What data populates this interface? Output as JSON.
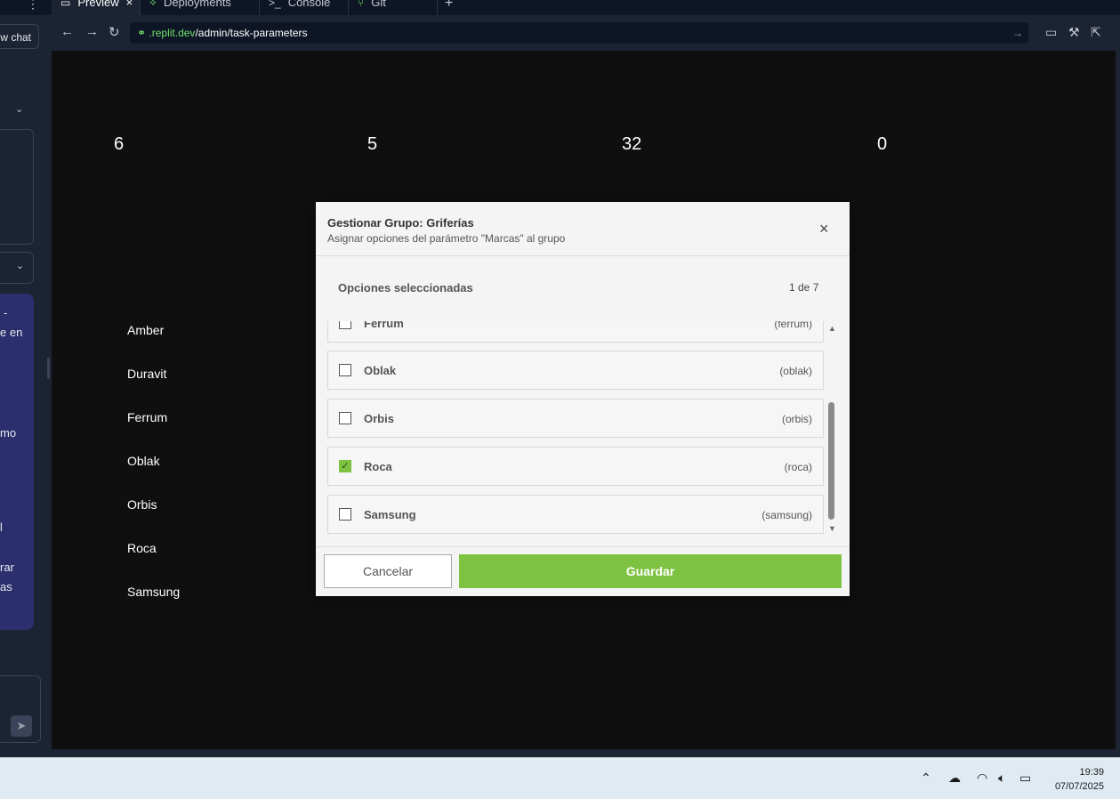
{
  "browser": {
    "tabs": [
      {
        "label": "Preview",
        "icon": "monitor-icon"
      },
      {
        "label": "Deployments",
        "icon": "rocket-icon"
      },
      {
        "label": "Console",
        "icon": "terminal-icon"
      },
      {
        "label": "Git",
        "icon": "git-icon"
      }
    ],
    "close_glyph": "×",
    "add_tab_glyph": "+",
    "url_domain": ".replit.dev",
    "url_path": "/admin/task-parameters"
  },
  "chat": {
    "new_chat_label": "w chat",
    "message_fragments": [
      "-",
      "e en",
      "mo",
      "l",
      "rar",
      "as"
    ]
  },
  "background": {
    "stat_values": [
      "6",
      "5",
      "32",
      "0"
    ],
    "row_labels": [
      "Amber",
      "Duravit",
      "Ferrum",
      "Oblak",
      "Orbis",
      "Roca",
      "Samsung"
    ]
  },
  "modal": {
    "title": "Gestionar Grupo: Griferías",
    "subtitle": "Asignar opciones del parámetro \"Marcas\" al grupo",
    "close_glyph": "×",
    "selected_label": "Opciones seleccionadas",
    "selected_count": "1 de 7",
    "options": [
      {
        "name": "Ferrum",
        "slug": "(ferrum)",
        "checked": false
      },
      {
        "name": "Oblak",
        "slug": "(oblak)",
        "checked": false
      },
      {
        "name": "Orbis",
        "slug": "(orbis)",
        "checked": false
      },
      {
        "name": "Roca",
        "slug": "(roca)",
        "checked": true
      },
      {
        "name": "Samsung",
        "slug": "(samsung)",
        "checked": false
      }
    ],
    "cancel_label": "Cancelar",
    "save_label": "Guardar"
  },
  "taskbar": {
    "time": "19:39",
    "date": "07/07/2025"
  },
  "colors": {
    "accent_green": "#7ec242",
    "ide_bg": "#1c2333",
    "taskbar_bg": "#dfeaf2"
  }
}
